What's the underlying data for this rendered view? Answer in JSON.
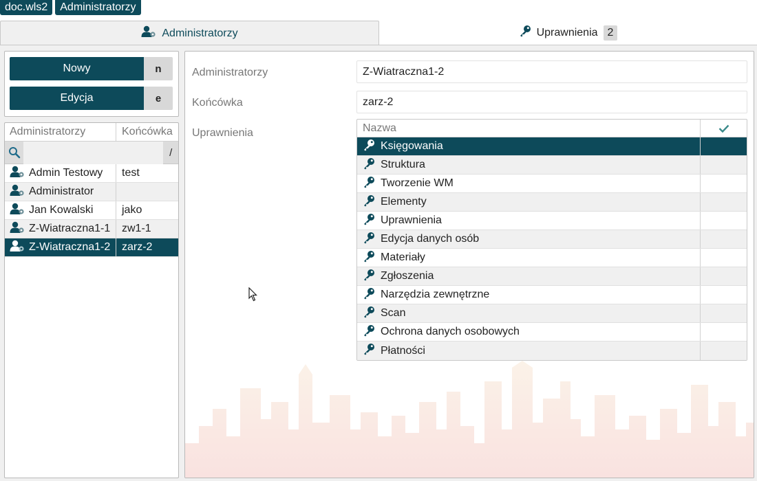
{
  "breadcrumbs": [
    "doc.wls2",
    "Administratorzy"
  ],
  "tabs": [
    {
      "label": "Administratorzy",
      "icon": "user-gear-icon",
      "active": true
    },
    {
      "label": "Uprawnienia",
      "icon": "key-icon",
      "badge": "2",
      "active": false
    }
  ],
  "actions": {
    "new": {
      "label": "Nowy",
      "key": "n"
    },
    "edit": {
      "label": "Edycja",
      "key": "e"
    }
  },
  "list": {
    "columns": [
      "Administratorzy",
      "Końcówka"
    ],
    "search_value": "",
    "search_shortcut": "/",
    "rows": [
      {
        "name": "Admin Testowy",
        "suffix": "test"
      },
      {
        "name": "Administrator",
        "suffix": ""
      },
      {
        "name": "Jan Kowalski",
        "suffix": "jako"
      },
      {
        "name": "Z-Wiatraczna1-1",
        "suffix": "zw1-1"
      },
      {
        "name": "Z-Wiatraczna1-2",
        "suffix": "zarz-2",
        "selected": true
      }
    ]
  },
  "detail": {
    "admin_label": "Administratorzy",
    "admin_value": "Z-Wiatraczna1-2",
    "suffix_label": "Końcówka",
    "suffix_value": "zarz-2",
    "permissions_label": "Uprawnienia",
    "permissions_table": {
      "name_header": "Nazwa",
      "check_header_icon": "check-icon",
      "rows": [
        {
          "name": "Księgowania",
          "selected": true
        },
        {
          "name": "Struktura"
        },
        {
          "name": "Tworzenie WM"
        },
        {
          "name": "Elementy"
        },
        {
          "name": "Uprawnienia"
        },
        {
          "name": "Edycja danych osób"
        },
        {
          "name": "Materiały"
        },
        {
          "name": "Zgłoszenia"
        },
        {
          "name": "Narzędzia zewnętrzne"
        },
        {
          "name": "Scan"
        },
        {
          "name": "Ochrona danych osobowych"
        },
        {
          "name": "Płatności"
        }
      ]
    }
  },
  "colors": {
    "accent": "#0d4a5a",
    "row_alt": "#f0f0f0",
    "key_bg": "#d8d8d8"
  }
}
